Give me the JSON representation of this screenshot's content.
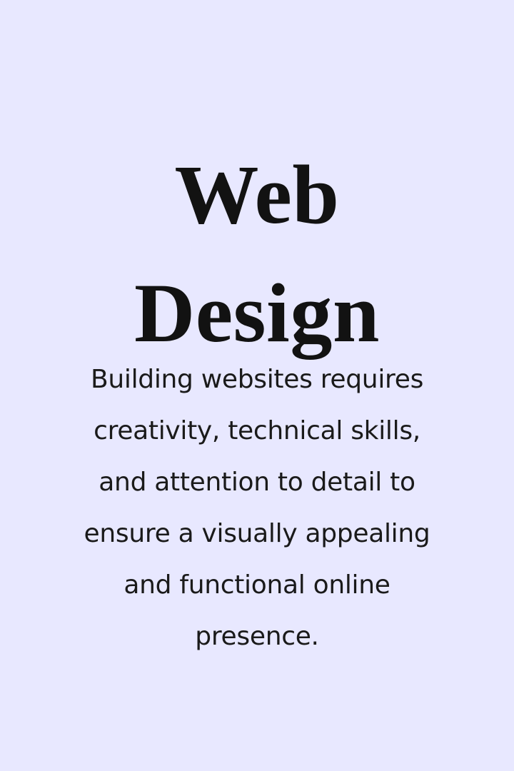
{
  "colors": {
    "background": "#e8e8ff",
    "title_text": "#121212",
    "body_text": "#1a1a1a"
  },
  "title": {
    "lines": [
      "Web",
      "Design"
    ]
  },
  "body": {
    "lines": [
      "Building websites requires",
      "creativity, technical skills,",
      "and attention to detail to",
      "ensure a visually appealing",
      "and functional online",
      "presence."
    ]
  }
}
